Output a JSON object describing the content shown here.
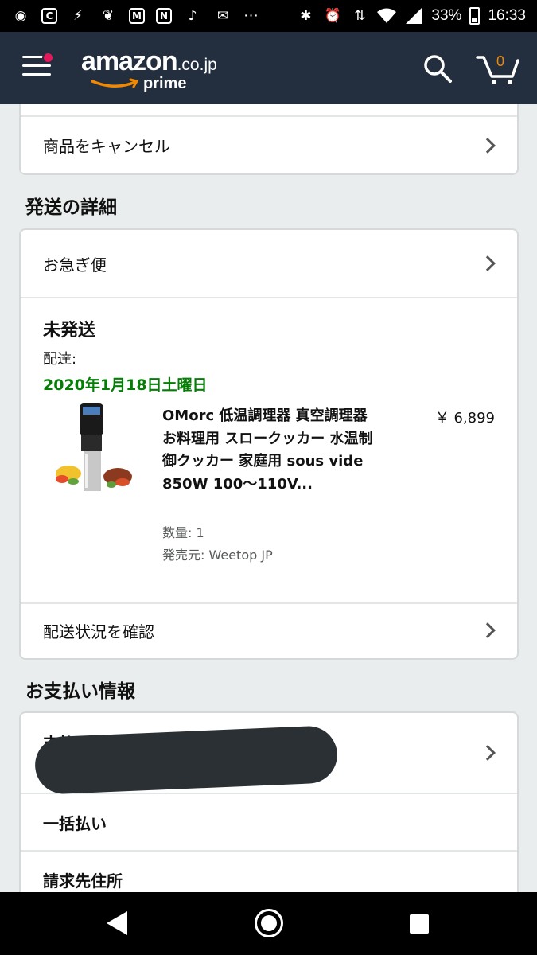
{
  "status_bar": {
    "battery": "33%",
    "time": "16:33",
    "dots": "···"
  },
  "header": {
    "logo_text": "amazon",
    "logo_domain": ".co.jp",
    "logo_sub": "prime",
    "cart_count": "0"
  },
  "cancel_row": {
    "label": "商品をキャンセル"
  },
  "shipping": {
    "section_title": "発送の詳細",
    "speed_label": "お急ぎ便",
    "status": "未発送",
    "delivery_label": "配達:",
    "delivery_date": "2020年1月18日土曜日",
    "item": {
      "title": "OMorc 低温調理器 真空調理器 お料理用 スロークッカー 水温制御クッカー 家庭用 sous vide 850W 100〜110V...",
      "price": "￥ 6,899",
      "quantity": "数量: 1",
      "seller": "発売元: Weetop JP"
    },
    "track_label": "配送状況を確認"
  },
  "payment": {
    "section_title": "お支払い情報",
    "method_label": "支払い方法",
    "plan_label": "一括払い",
    "billing_label": "請求先住所"
  },
  "colors": {
    "header_bg": "#232f3e",
    "delivery_green": "#067d06",
    "cart_orange": "#f08804"
  }
}
